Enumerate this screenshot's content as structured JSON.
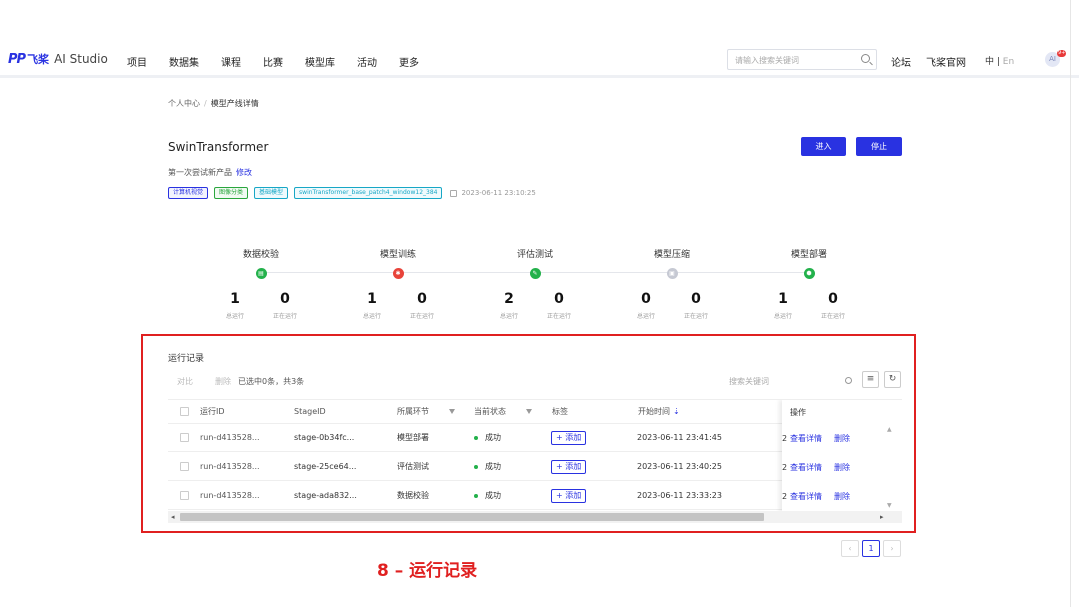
{
  "nav": {
    "logo_mark": "PP",
    "logo_cn": "飞桨",
    "logo_ai": "AI Studio",
    "items": [
      "项目",
      "数据集",
      "课程",
      "比赛",
      "模型库",
      "活动",
      "更多"
    ],
    "search_placeholder": "请输入搜索关键词",
    "forum": "论坛",
    "official_site": "飞桨官网",
    "lang_cn": "中 | ",
    "lang_en": "En",
    "avatar_text": "AI",
    "badge": "9+"
  },
  "breadcrumb": {
    "home": "个人中心",
    "separator": "/",
    "current": "模型产线详情"
  },
  "model": {
    "title": "SwinTransformer",
    "desc": "第一次尝试新产品",
    "edit_link": "修改",
    "enter_button": "进入",
    "stop_button": "停止",
    "tags": [
      "计算机视觉",
      "图像分类",
      "基础模型",
      "swinTransformer_base_patch4_window12_384"
    ],
    "created": "2023-06-11 23:10:25"
  },
  "pipeline": [
    {
      "name": "数据校验",
      "status": "green",
      "icon": "database-icon",
      "glyph": "▤",
      "run_total": "1",
      "running": "0"
    },
    {
      "name": "模型训练",
      "status": "red",
      "icon": "train-icon",
      "glyph": "✱",
      "run_total": "1",
      "running": "0"
    },
    {
      "name": "评估测试",
      "status": "green",
      "icon": "evaluate-icon",
      "glyph": "✎",
      "run_total": "2",
      "running": "0"
    },
    {
      "name": "模型压缩",
      "status": "gray",
      "icon": "compress-icon",
      "glyph": "▣",
      "run_total": "0",
      "running": "0"
    },
    {
      "name": "模型部署",
      "status": "green",
      "icon": "deploy-icon",
      "glyph": "⬢",
      "run_total": "1",
      "running": "0"
    }
  ],
  "stat_labels": {
    "total": "总运行",
    "running": "正在运行"
  },
  "records": {
    "title": "运行记录",
    "compare": "对比",
    "delete": "删除",
    "selection_info": "已选中0条，共3条",
    "keyword_placeholder": "搜索关键词",
    "columns": [
      "运行ID",
      "StageID",
      "所属环节",
      "当前状态",
      "标签",
      "开始时间",
      "操作"
    ],
    "rows": [
      {
        "run_id": "run-d413528...",
        "stage_id": "stage-0b34fc...",
        "stage": "模型部署",
        "status": "成功",
        "tag": "+ 添加",
        "start": "2023-06-11 23:41:45",
        "extra": "2"
      },
      {
        "run_id": "run-d413528...",
        "stage_id": "stage-25ce64...",
        "stage": "评估测试",
        "status": "成功",
        "tag": "+ 添加",
        "start": "2023-06-11 23:40:25",
        "extra": "2"
      },
      {
        "run_id": "run-d413528...",
        "stage_id": "stage-ada832...",
        "stage": "数据校验",
        "status": "成功",
        "tag": "+ 添加",
        "start": "2023-06-11 23:33:23",
        "extra": "2"
      }
    ],
    "view_detail": "查看详情",
    "row_delete": "删除"
  },
  "pagination": {
    "prev": "‹",
    "current": "1",
    "next": "›"
  },
  "caption": "8 – 运行记录",
  "colors": {
    "brand": "#2932e1",
    "success": "#23b14b",
    "error": "#e8433a",
    "highlight": "#e02020"
  }
}
